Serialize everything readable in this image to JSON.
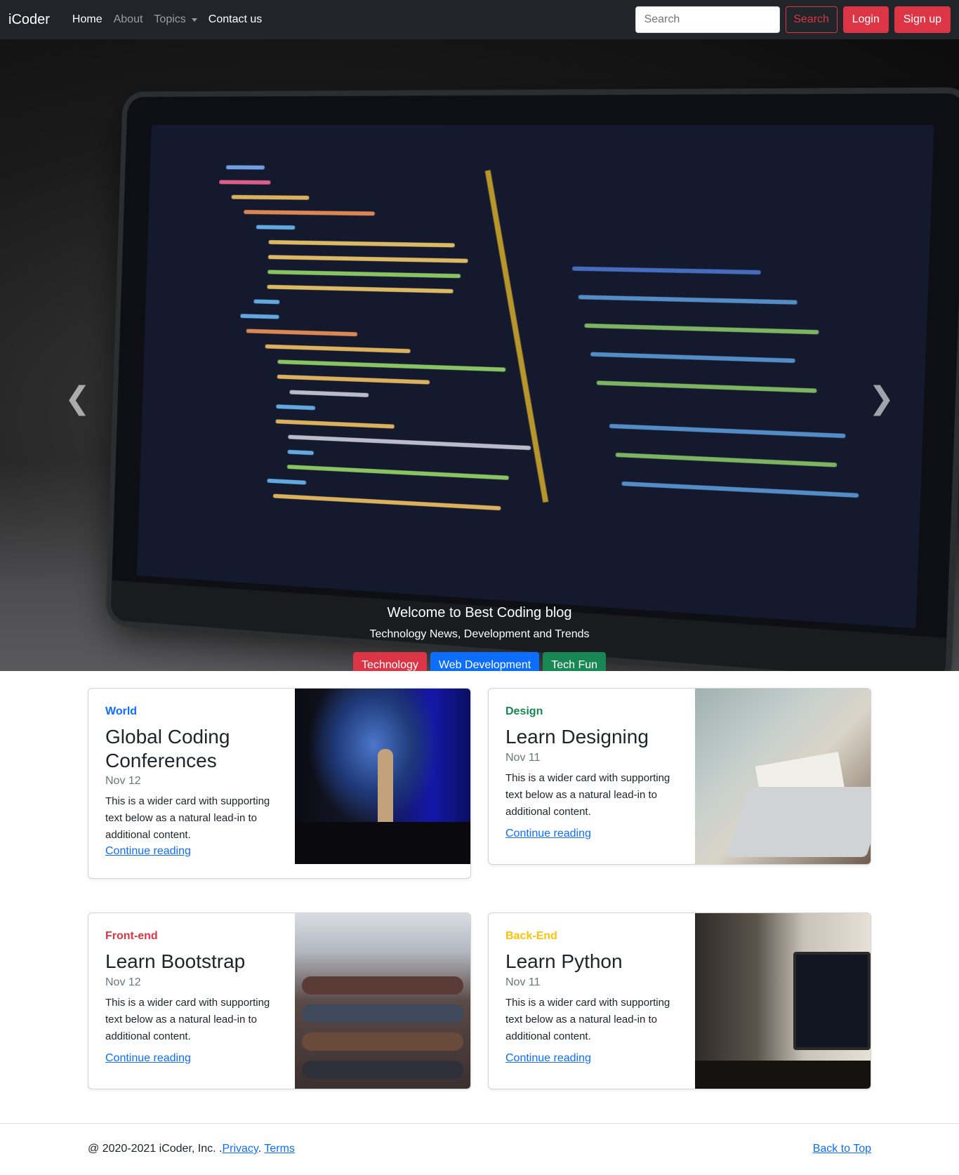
{
  "navbar": {
    "brand": "iCoder",
    "links": [
      "Home",
      "About",
      "Topics",
      "Contact us"
    ],
    "search_placeholder": "Search",
    "search_button": "Search",
    "login": "Login",
    "signup": "Sign up"
  },
  "hero": {
    "title": "Welcome to Best Coding blog",
    "subtitle": "Technology News, Development and Trends",
    "buttons": [
      "Technology",
      "Web Development",
      "Tech Fun"
    ],
    "active_slide": 2,
    "slide_count": 3
  },
  "cards": [
    {
      "category": "World",
      "title": "Global Coding Conferences",
      "date": "Nov 12",
      "text": "This is a wider card with supporting text below as a natural lead-in to additional content.",
      "link": "Continue reading"
    },
    {
      "category": "Design",
      "title": "Learn Designing",
      "date": "Nov 11",
      "text": "This is a wider card with supporting text below as a natural lead-in to additional content.",
      "link": "Continue reading"
    },
    {
      "category": "Front-end",
      "title": "Learn Bootstrap",
      "date": "Nov 12",
      "text": "This is a wider card with supporting text below as a natural lead-in to additional content.",
      "link": "Continue reading"
    },
    {
      "category": "Back-End",
      "title": "Learn Python",
      "date": "Nov 11",
      "text": "This is a wider card with supporting text below as a natural lead-in to additional content.",
      "link": "Continue reading"
    }
  ],
  "footer": {
    "copyright": "@ 2020-2021 iCoder, Inc. .",
    "privacy": "Privacy",
    "separator": ". ",
    "terms": "Terms",
    "back_to_top": "Back to Top"
  },
  "colors": {
    "navbar_bg": "#212529",
    "danger": "#dc3545",
    "primary": "#0d6efd",
    "success": "#198754",
    "warning": "#ffc107"
  }
}
